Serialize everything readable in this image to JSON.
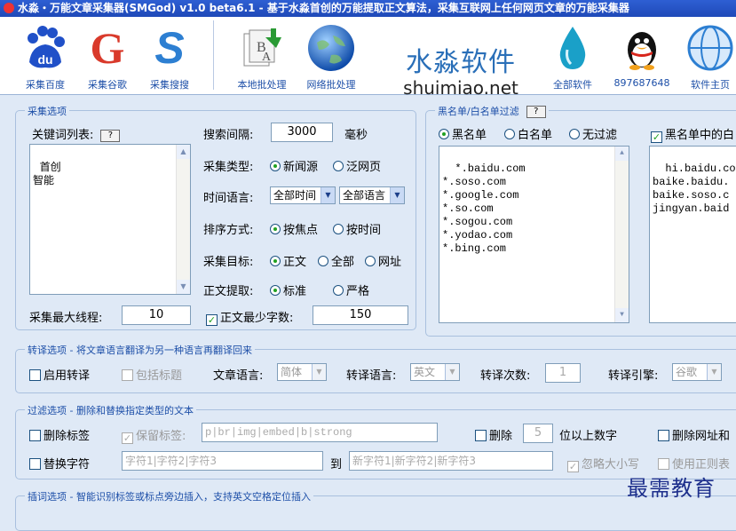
{
  "window": {
    "title": "水淼・万能文章采集器(SMGod) v1.0 beta6.1 - 基于水淼首创的万能提取正文算法，采集互联网上任何网页文章的万能采集器"
  },
  "toolbar": {
    "buttons": [
      {
        "label": "采集百度",
        "icon": "baidu-icon",
        "color": "#2050c8"
      },
      {
        "label": "采集谷歌",
        "icon": "google-icon",
        "color": "#d93a2b"
      },
      {
        "label": "采集搜搜",
        "icon": "soso-icon",
        "color": "#2d7fd2"
      },
      {
        "label": "本地批处理",
        "icon": "local-batch-icon",
        "color": "#2a9a34"
      },
      {
        "label": "网络批处理",
        "icon": "globe-icon",
        "color": "#1d62c4"
      },
      {
        "label": "全部软件",
        "icon": "water-drop-icon",
        "color": "#1aa0c8"
      },
      {
        "label": "897687648",
        "icon": "qq-penguin-icon",
        "color": "#111111"
      },
      {
        "label": "软件主页",
        "icon": "homepage-icon",
        "color": "#2d7fd2"
      }
    ],
    "brand_cn": "水淼软件",
    "brand_en": "shuimiao.net"
  },
  "collect": {
    "title": "采集选项",
    "keywords_label": "关键词列表:",
    "help": "?",
    "keywords": "首创\n智能",
    "interval_label": "搜索间隔:",
    "interval_value": "3000",
    "interval_unit": "毫秒",
    "type_label": "采集类型:",
    "type_news": "新闻源",
    "type_web": "泛网页",
    "time_lang_label": "时间语言:",
    "time_value": "全部时间",
    "lang_value": "全部语言",
    "sort_label": "排序方式:",
    "sort_focus": "按焦点",
    "sort_time": "按时间",
    "target_label": "采集目标:",
    "target_body": "正文",
    "target_all": "全部",
    "target_url": "网址",
    "extract_label": "正文提取:",
    "extract_std": "标准",
    "extract_strict": "严格",
    "threads_label": "采集最大线程:",
    "threads_value": "10",
    "minwords_label": "正文最少字数:",
    "minwords_value": "150"
  },
  "filter_list": {
    "title": "黑名单/白名单过滤",
    "help": "?",
    "black": "黑名单",
    "white": "白名单",
    "none": "无过滤",
    "blacklist": "*.baidu.com\n*.soso.com\n*.google.com\n*.so.com\n*.sogou.com\n*.yodao.com\n*.bing.com",
    "black_in_label": "黑名单中的白",
    "whitelist": "hi.baidu.com\nbaike.baidu.\nbaike.soso.c\njingyan.baid"
  },
  "translate": {
    "title": "转译选项 - 将文章语言翻译为另一种语言再翻译回来",
    "enable": "启用转译",
    "include_title": "包括标题",
    "src_lang_label": "文章语言:",
    "src_lang": "简体",
    "dst_lang_label": "转译语言:",
    "dst_lang": "英文",
    "count_label": "转译次数:",
    "count": "1",
    "engine_label": "转译引擎:",
    "engine": "谷歌"
  },
  "filter_text": {
    "title": "过滤选项 - 删除和替换指定类型的文本",
    "del_tags": "删除标签",
    "keep_tags": "保留标签:",
    "keep_tags_value": "p|br|img|embed|b|strong",
    "delete": "删除",
    "digits": "5",
    "digits_suffix": "位以上数字",
    "del_url": "删除网址和",
    "replace": "替换字符",
    "from_value": "字符1|字符2|字符3",
    "to": "到",
    "to_value": "新字符1|新字符2|新字符3",
    "ignore_case": "忽略大小写",
    "use_regex": "使用正则表"
  },
  "insert": {
    "title": "插词选项 - 智能识别标签或标点旁边插入，支持英文空格定位插入"
  },
  "watermark": "最需教育"
}
